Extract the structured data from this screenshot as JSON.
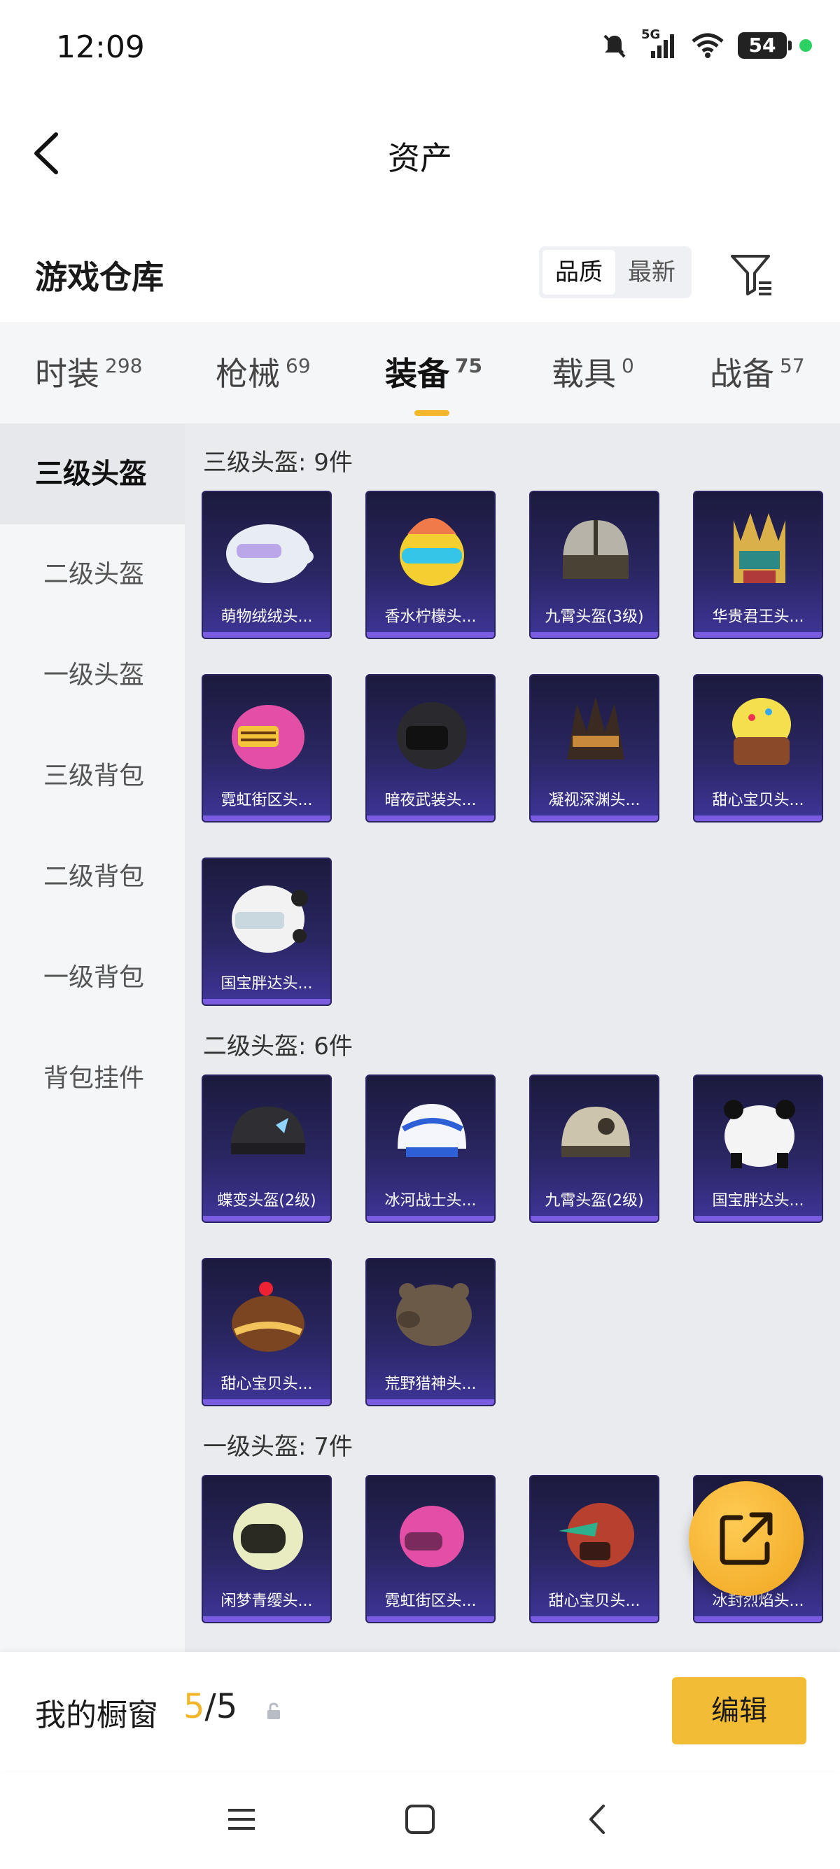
{
  "status_bar": {
    "time": "12:09",
    "network": "5G",
    "battery": "54"
  },
  "nav": {
    "title": "资产"
  },
  "warehouse": {
    "title": "游戏仓库",
    "sort_options": [
      "品质",
      "最新"
    ],
    "active_sort": "品质"
  },
  "tabs": [
    {
      "label": "时装",
      "count": "298"
    },
    {
      "label": "枪械",
      "count": "69"
    },
    {
      "label": "装备",
      "count": "75"
    },
    {
      "label": "载具",
      "count": "0"
    },
    {
      "label": "战备",
      "count": "57"
    }
  ],
  "sidebar": {
    "items": [
      {
        "label": "三级头盔"
      },
      {
        "label": "二级头盔"
      },
      {
        "label": "一级头盔"
      },
      {
        "label": "三级背包"
      },
      {
        "label": "二级背包"
      },
      {
        "label": "一级背包"
      },
      {
        "label": "背包挂件"
      }
    ]
  },
  "sections": [
    {
      "title": "三级头盔: 9件",
      "items": [
        "萌物绒绒头...",
        "香水柠檬头...",
        "九霄头盔(3级)",
        "华贵君王头...",
        "霓虹街区头...",
        "暗夜武装头...",
        "凝视深渊头...",
        "甜心宝贝头...",
        "国宝胖达头..."
      ]
    },
    {
      "title": "二级头盔: 6件",
      "items": [
        "蝶变头盔(2级)",
        "冰河战士头...",
        "九霄头盔(2级)",
        "国宝胖达头...",
        "甜心宝贝头...",
        "荒野猎神头..."
      ]
    },
    {
      "title": "一级头盔: 7件",
      "items": [
        "闲梦青缨头...",
        "霓虹街区头...",
        "甜心宝贝头...",
        "冰封烈焰头..."
      ]
    }
  ],
  "showcase": {
    "label": "我的橱窗",
    "current": "5",
    "total": "/5",
    "edit_label": "编辑"
  },
  "colors": {
    "accent": "#f3b62b",
    "card_bg": "#2a2662",
    "card_bar": "#7a5ce0"
  }
}
